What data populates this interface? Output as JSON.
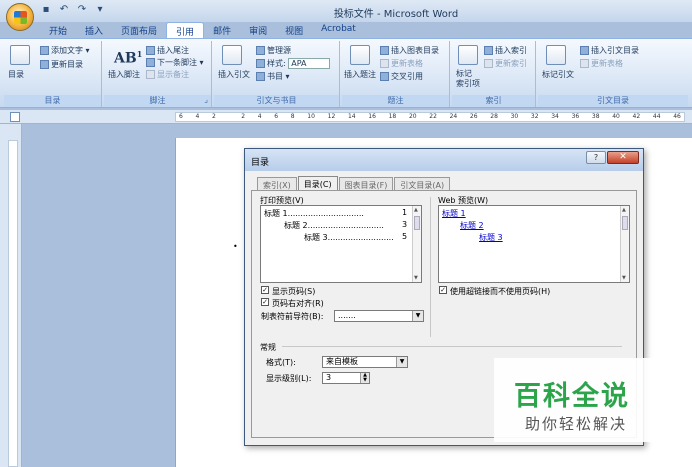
{
  "window": {
    "title": "投标文件 - Microsoft Word"
  },
  "ribbon_tabs": [
    "开始",
    "插入",
    "页面布局",
    "引用",
    "邮件",
    "审阅",
    "视图",
    "Acrobat"
  ],
  "active_tab": "引用",
  "ribbon": {
    "toc": {
      "label": "目录",
      "add_text": "添加文字 ▾",
      "update": "更新目录",
      "group": "目录"
    },
    "footnotes": {
      "insert_footnote": "插入脚注",
      "insert_endnote": "插入尾注",
      "next_footnote": "下一条脚注 ▾",
      "show_notes": "显示备注",
      "group": "脚注"
    },
    "citations": {
      "insert_citation": "插入引文",
      "manage_sources": "管理源",
      "style_label": "样式:",
      "style_value": "APA",
      "bibliography": "书目 ▾",
      "group": "引文与书目"
    },
    "captions": {
      "insert_caption": "插入题注",
      "insert_table_of_figures": "插入图表目录",
      "update_table": "更新表格",
      "cross_reference": "交叉引用",
      "group": "题注"
    },
    "index": {
      "mark_entry": "标记\n索引项",
      "insert_index": "插入索引",
      "update_index": "更新索引",
      "group": "索引"
    },
    "toa": {
      "mark_citation": "标记引文",
      "insert_toa": "插入引文目录",
      "update_table": "更新表格",
      "group": "引文目录"
    }
  },
  "ruler_numbers": [
    "6",
    "4",
    "2",
    "",
    "2",
    "4",
    "6",
    "8",
    "10",
    "12",
    "14",
    "16",
    "18",
    "20",
    "22",
    "24",
    "26",
    "28",
    "30",
    "32",
    "34",
    "36",
    "38",
    "40",
    "42",
    "44",
    "46"
  ],
  "dialog": {
    "title": "目录",
    "help": "?",
    "close": "✕",
    "tabs": [
      "索引(X)",
      "目录(C)",
      "图表目录(F)",
      "引文目录(A)"
    ],
    "active_tab": "目录(C)",
    "print_preview_label": "打印预览(V)",
    "print_preview": [
      {
        "text": "标题 1..............................",
        "page": "1"
      },
      {
        "text": "标题 2..............................",
        "page": "3"
      },
      {
        "text": "标题 3..........................",
        "page": "5"
      }
    ],
    "web_preview_label": "Web 预览(W)",
    "web_preview": [
      "标题 1",
      "标题 2",
      "标题 3"
    ],
    "show_page_numbers": "显示页码(S)",
    "right_align_page_numbers": "页码右对齐(R)",
    "tab_leader_label": "制表符前导符(B):",
    "tab_leader_value": ".......",
    "use_hyperlinks": "使用超链接而不使用页码(H)",
    "general_label": "常规",
    "formats_label": "格式(T):",
    "formats_value": "来自模板",
    "show_levels_label": "显示级别(L):",
    "show_levels_value": "3"
  },
  "watermark": {
    "main": "百科全说",
    "sub": "助你轻松解决"
  }
}
